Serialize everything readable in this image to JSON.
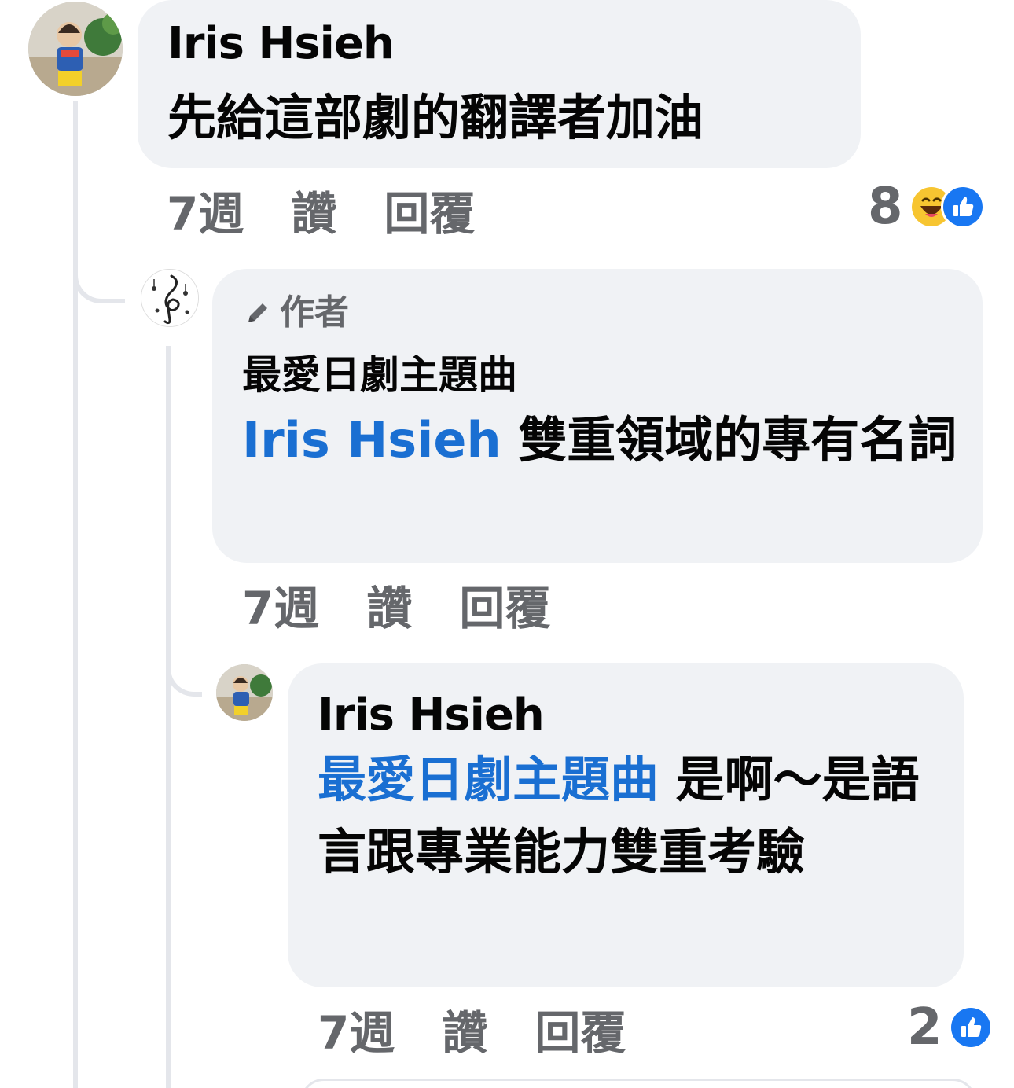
{
  "comments": [
    {
      "author": "Iris Hsieh",
      "text": "先給這部劇的翻譯者加油",
      "time": "7週",
      "like_label": "讚",
      "reply_label": "回覆",
      "reaction_count": "8",
      "reaction_icons": [
        "haha-icon",
        "like-icon"
      ]
    },
    {
      "badge": "作者",
      "author": "最愛日劇主題曲",
      "mention": "Iris Hsieh",
      "text": " 雙重領域的專有名詞",
      "time": "7週",
      "like_label": "讚",
      "reply_label": "回覆"
    },
    {
      "author": "Iris Hsieh",
      "mention": "最愛日劇主題曲",
      "text": " 是啊～是語言跟專業能力雙重考驗",
      "time": "7週",
      "like_label": "讚",
      "reply_label": "回覆",
      "reaction_count": "2",
      "reaction_icons": [
        "like-icon"
      ]
    }
  ],
  "colors": {
    "bubble": "#f0f2f5",
    "mention": "#1a6fd2",
    "meta": "#65676b",
    "like_blue": "#1877f2",
    "haha_yellow": "#f7c531"
  }
}
